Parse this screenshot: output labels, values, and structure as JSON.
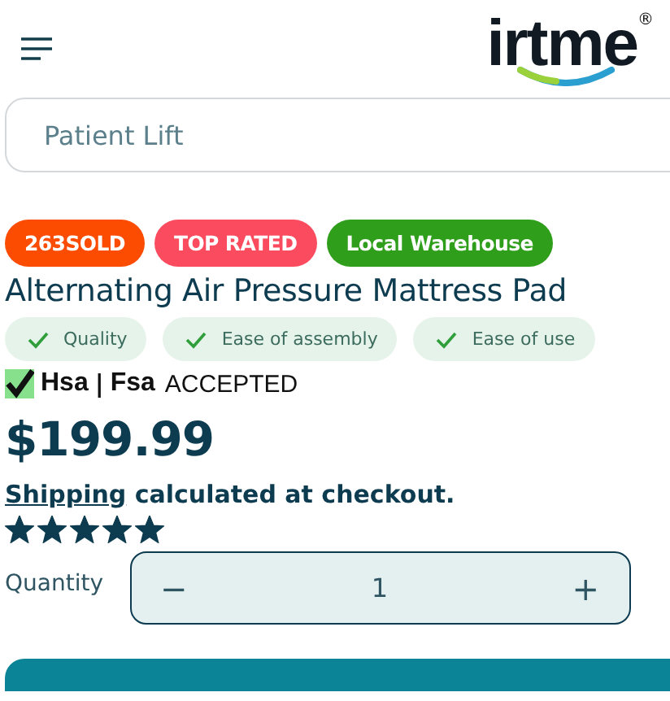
{
  "header": {
    "logo": "irtme",
    "logo_mark": "®"
  },
  "search": {
    "placeholder": "Patient Lift"
  },
  "badges": [
    {
      "label": "263SOLD",
      "color": "#fc4c02"
    },
    {
      "label": "TOP RATED",
      "color": "#fb4b5f"
    },
    {
      "label": "Local Warehouse",
      "color": "#2f9e1b"
    }
  ],
  "title": "Alternating Air Pressure Mattress Pad",
  "features": [
    "Quality",
    "Ease of assembly",
    "Ease of use"
  ],
  "payment": {
    "hsa": "Hsa",
    "separator": "|",
    "fsa": "Fsa",
    "note": "ACCEPTED"
  },
  "price": "$199.99",
  "shipping": {
    "link": "Shipping",
    "text": "calculated at checkout."
  },
  "rating": {
    "stars": 5
  },
  "quantity": {
    "label": "Quantity",
    "minus": "−",
    "value": "1",
    "plus": "+"
  }
}
